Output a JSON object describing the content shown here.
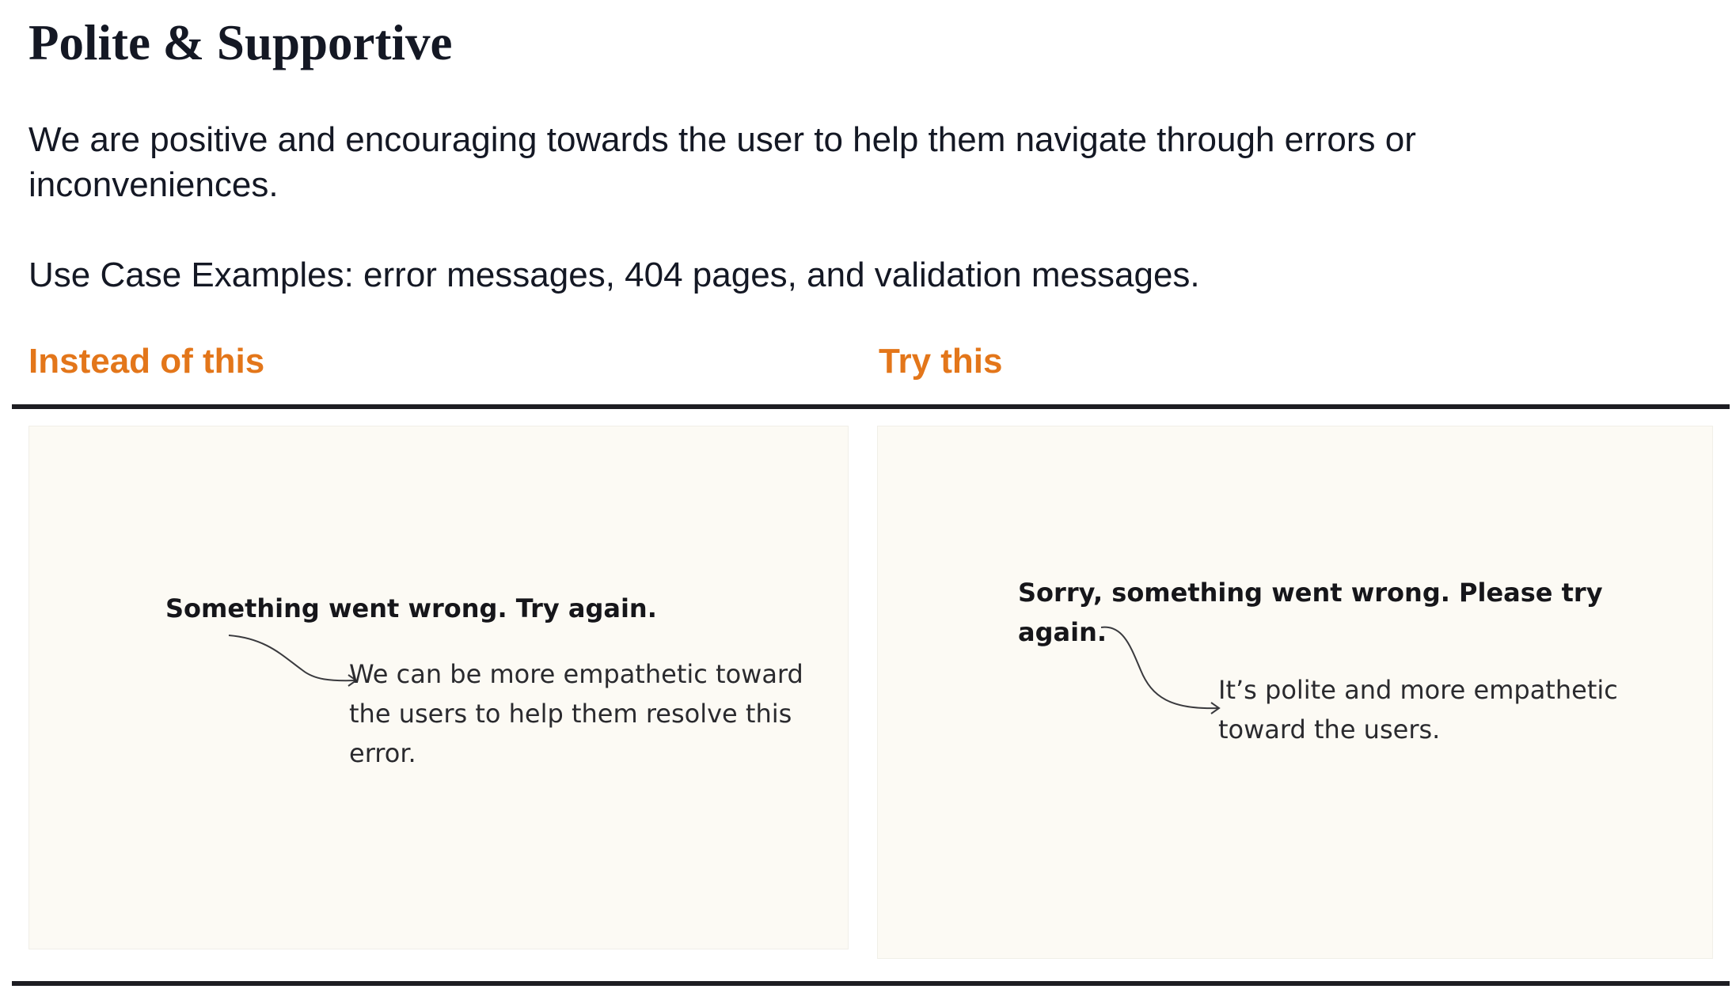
{
  "page": {
    "title": "Polite & Supportive",
    "description": "We are positive and encouraging towards the user to help them navigate through errors or inconveniences.",
    "use_cases": "Use Case Examples: error messages, 404 pages, and validation messages."
  },
  "columns": {
    "left_heading": "Instead of this",
    "right_heading": "Try this"
  },
  "examples": {
    "bad": {
      "message": "Something went wrong. Try again.",
      "note": "We can be more empathetic toward the users to help them resolve this error."
    },
    "good": {
      "message": "Sorry, something went wrong. Please try again.",
      "note": "It’s polite and more empathetic toward the users."
    }
  },
  "colors": {
    "heading_accent": "#e3761a",
    "panel_background": "#fcfaf4",
    "rule": "#1d1d22",
    "text": "#141824"
  },
  "icons": [
    "curved-arrow-icon"
  ]
}
